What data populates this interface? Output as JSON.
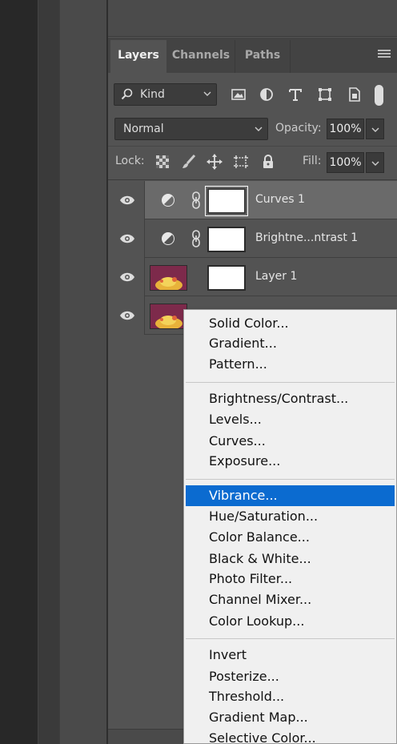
{
  "tabs": [
    {
      "label": "Layers",
      "active": true
    },
    {
      "label": "Channels",
      "active": false
    },
    {
      "label": "Paths",
      "active": false
    }
  ],
  "filter": {
    "kind_label": "Kind"
  },
  "blend": {
    "mode": "Normal",
    "opacity_label": "Opacity:",
    "opacity": "100%"
  },
  "lock": {
    "label": "Lock:",
    "fill_label": "Fill:",
    "fill": "100%"
  },
  "layers": [
    {
      "name": "Curves 1",
      "type": "adjustment",
      "selected": true
    },
    {
      "name": "Brightne...ntrast 1",
      "type": "adjustment",
      "selected": false
    },
    {
      "name": "Layer 1",
      "type": "pixel",
      "selected": false
    },
    {
      "name": "",
      "type": "pixel",
      "selected": false
    }
  ],
  "menu": {
    "highlighted": "Vibrance...",
    "groups": [
      [
        "Solid Color...",
        "Gradient...",
        "Pattern..."
      ],
      [
        "Brightness/Contrast...",
        "Levels...",
        "Curves...",
        "Exposure..."
      ],
      [
        "Vibrance...",
        "Hue/Saturation...",
        "Color Balance...",
        "Black & White...",
        "Photo Filter...",
        "Channel Mixer...",
        "Color Lookup..."
      ],
      [
        "Invert",
        "Posterize...",
        "Threshold...",
        "Gradient Map...",
        "Selective Color..."
      ]
    ]
  },
  "colors": {
    "highlight": "#0b6bd0",
    "panel": "#535353",
    "selected_row": "#6a6a6a"
  }
}
